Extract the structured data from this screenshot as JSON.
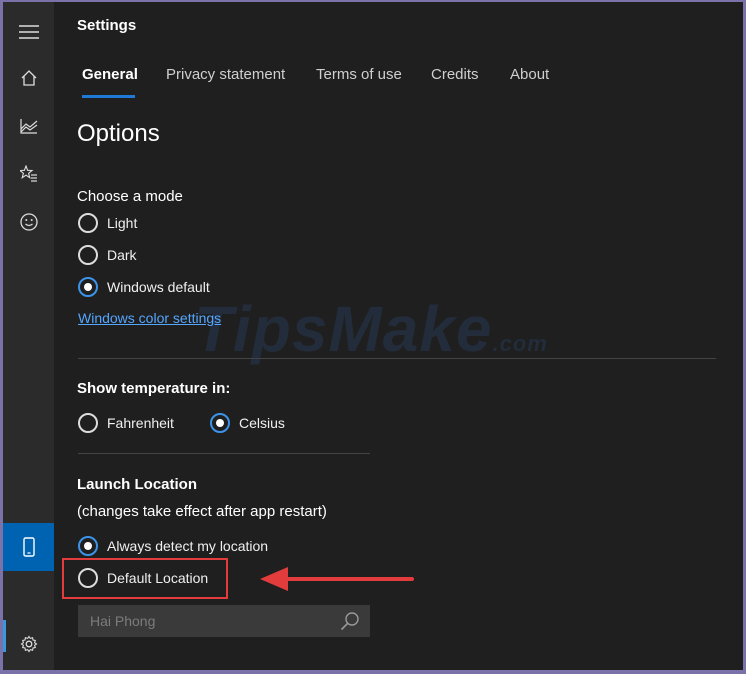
{
  "app": {
    "title": "Settings"
  },
  "tabs": [
    {
      "label": "General",
      "active": true
    },
    {
      "label": "Privacy statement"
    },
    {
      "label": "Terms of use"
    },
    {
      "label": "Credits"
    },
    {
      "label": "About"
    }
  ],
  "sidebar": {
    "items": [
      {
        "icon": "hamburger-menu-icon"
      },
      {
        "icon": "home-icon"
      },
      {
        "icon": "chart-icon"
      },
      {
        "icon": "favorites-icon"
      },
      {
        "icon": "smiley-icon"
      },
      {
        "icon": "phone-icon",
        "active": true
      },
      {
        "icon": "gear-icon"
      }
    ]
  },
  "options": {
    "heading": "Options",
    "mode": {
      "label": "Choose a mode",
      "choices": [
        "Light",
        "Dark",
        "Windows default"
      ],
      "selected": "Windows default",
      "link": "Windows color settings"
    },
    "temperature": {
      "label": "Show temperature in:",
      "choices": [
        "Fahrenheit",
        "Celsius"
      ],
      "selected": "Celsius"
    },
    "launch": {
      "label": "Launch Location",
      "note": "(changes take effect after app restart)",
      "choices": [
        "Always detect my location",
        "Default Location"
      ],
      "selected": "Always detect my location",
      "search_placeholder": "Hai Phong"
    }
  },
  "watermark": {
    "text": "TipsMake",
    "suffix": ".com"
  },
  "colors": {
    "accent": "#0063b1",
    "annotation": "#e33c3c",
    "link": "#54a6ff"
  }
}
